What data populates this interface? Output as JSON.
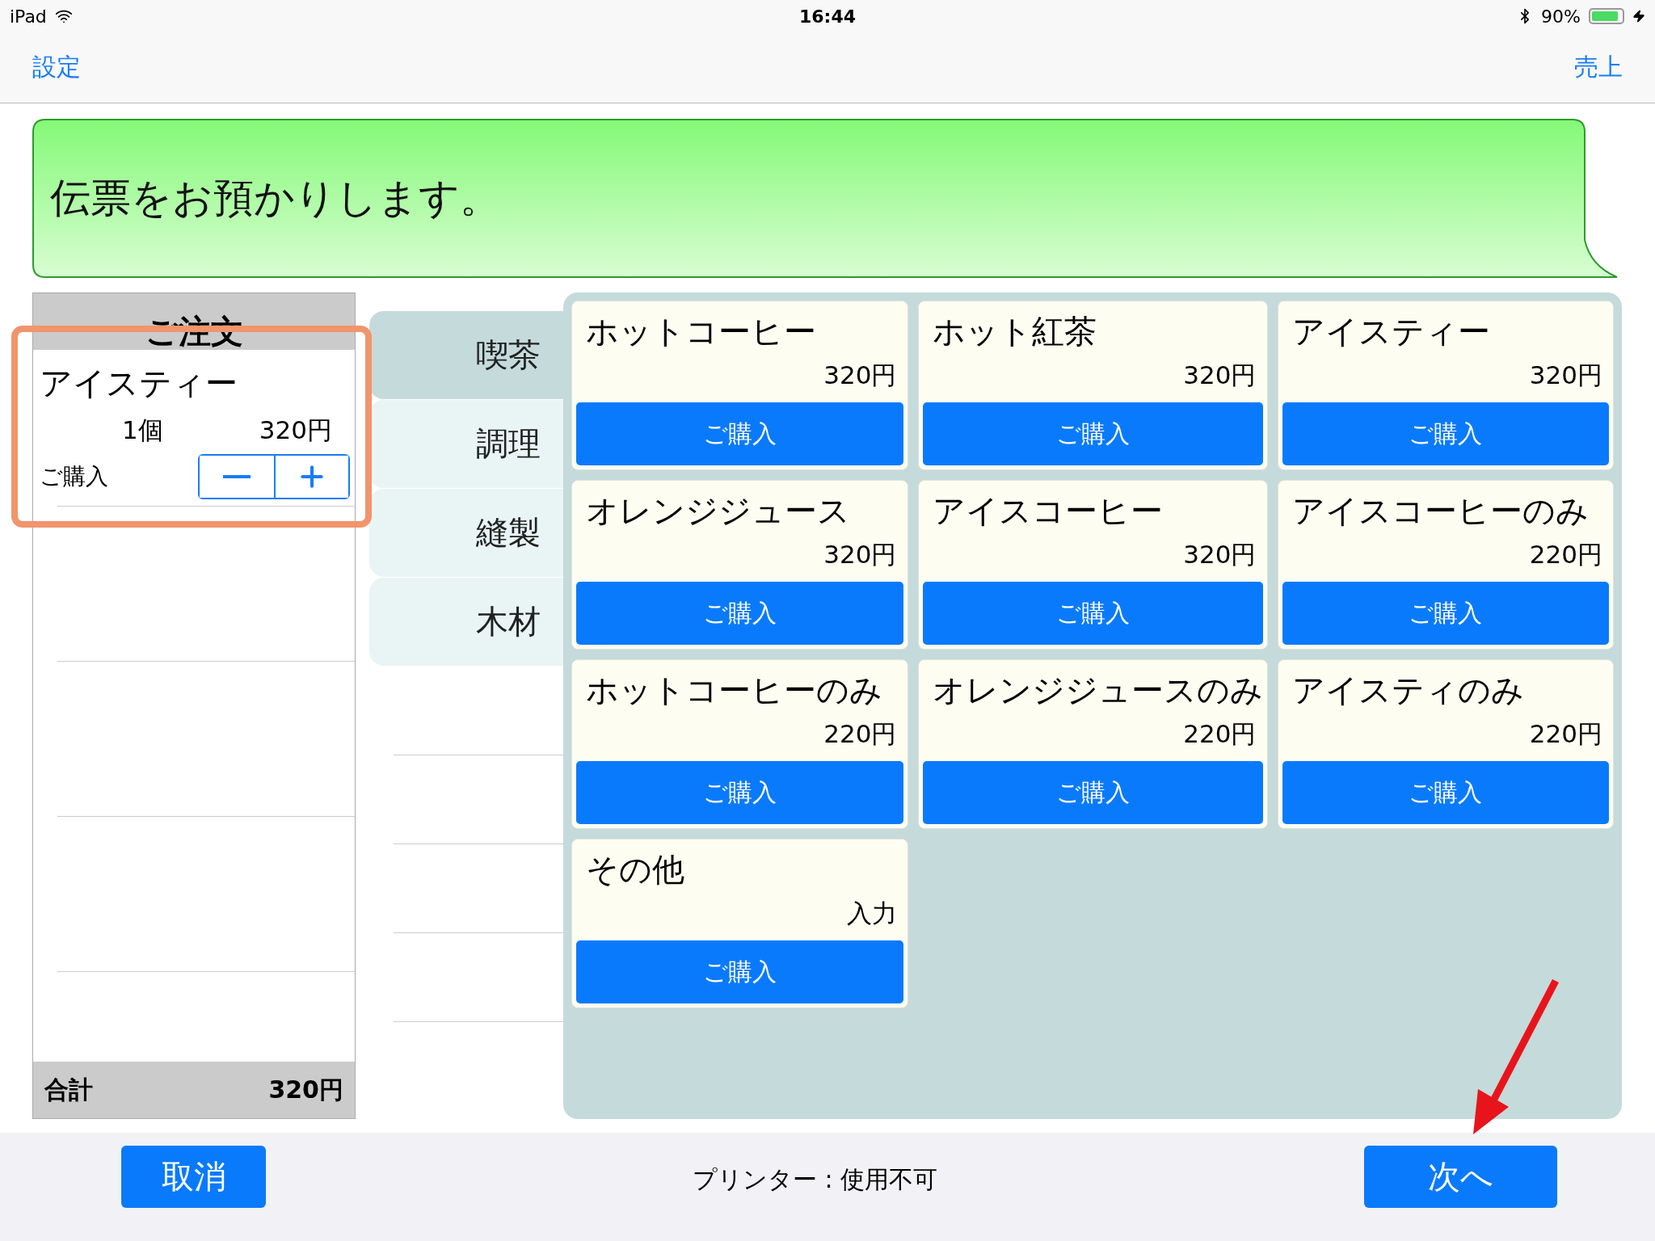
{
  "status_bar": {
    "device": "iPad",
    "time": "16:44",
    "battery": "90%"
  },
  "nav": {
    "left": "設定",
    "right": "売上"
  },
  "message": "伝票をお預かりします。",
  "order": {
    "title": "ご注文",
    "items": [
      {
        "name": "アイスティー",
        "quantity": "1個",
        "price": "320円",
        "label": "ご購入"
      }
    ],
    "total_label": "合計",
    "total": "320円"
  },
  "categories": [
    {
      "label": "喫茶",
      "selected": true
    },
    {
      "label": "調理",
      "selected": false
    },
    {
      "label": "縫製",
      "selected": false
    },
    {
      "label": "木材",
      "selected": false
    }
  ],
  "products": [
    {
      "name": "ホットコーヒー",
      "price": "320円",
      "button": "ご購入"
    },
    {
      "name": "ホット紅茶",
      "price": "320円",
      "button": "ご購入"
    },
    {
      "name": "アイスティー",
      "price": "320円",
      "button": "ご購入"
    },
    {
      "name": "オレンジジュース",
      "price": "320円",
      "button": "ご購入"
    },
    {
      "name": "アイスコーヒー",
      "price": "320円",
      "button": "ご購入"
    },
    {
      "name": "アイスコーヒーのみ",
      "price": "220円",
      "button": "ご購入"
    },
    {
      "name": "ホットコーヒーのみ",
      "price": "220円",
      "button": "ご購入"
    },
    {
      "name": "オレンジジュースのみ",
      "price": "220円",
      "button": "ご購入"
    },
    {
      "name": "アイスティのみ",
      "price": "220円",
      "button": "ご購入"
    },
    {
      "name": "その他",
      "price": "入力",
      "button": "ご購入"
    }
  ],
  "bottom_bar": {
    "cancel": "取消",
    "printer_status": "プリンター : 使用不可",
    "next": "次へ"
  }
}
